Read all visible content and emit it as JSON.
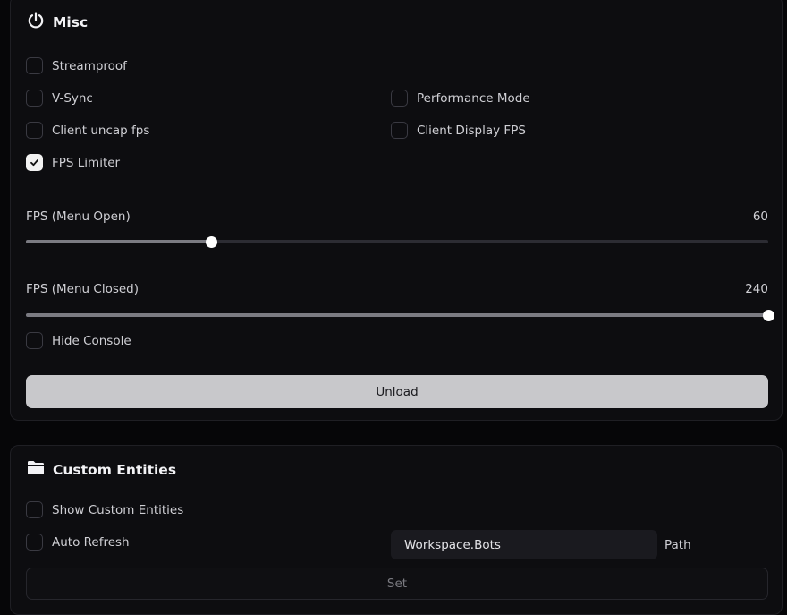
{
  "misc": {
    "title": "Misc",
    "icon": "power-icon",
    "checkboxes": [
      {
        "label": "Streamproof",
        "checked": false
      },
      {
        "label": "V-Sync",
        "checked": false
      },
      {
        "label": "Performance Mode",
        "checked": false
      },
      {
        "label": "Client uncap fps",
        "checked": false
      },
      {
        "label": "Client Display FPS",
        "checked": false
      },
      {
        "label": "FPS Limiter",
        "checked": true
      }
    ],
    "sliders": [
      {
        "label": "FPS (Menu Open)",
        "value": "60",
        "fill_fraction": 0.25
      },
      {
        "label": "FPS (Menu Closed)",
        "value": "240",
        "fill_fraction": 1.0
      }
    ],
    "hide_console": {
      "label": "Hide Console",
      "checked": false
    },
    "unload_label": "Unload"
  },
  "custom_entities": {
    "title": "Custom Entities",
    "icon": "folder-icon",
    "show_custom_entities": {
      "label": "Show Custom Entities",
      "checked": false
    },
    "auto_refresh": {
      "label": "Auto Refresh",
      "checked": false
    },
    "path_input_value": "Workspace.Bots",
    "path_label": "Path",
    "set_label": "Set"
  },
  "colors": {
    "background": "#060608",
    "panel": "#0d0d10",
    "accent": "#c8c8cb",
    "slider_fill": "#7b7b82"
  }
}
